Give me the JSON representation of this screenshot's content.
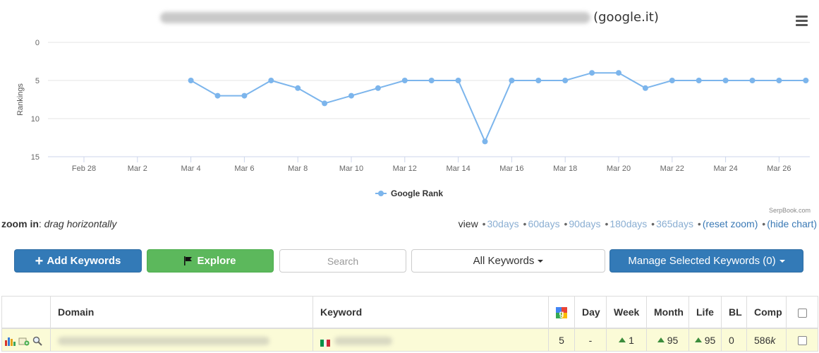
{
  "chart": {
    "title_suffix": "(google.it)",
    "credit": "SerpBook.com"
  },
  "chart_data": {
    "type": "line",
    "title": "(google.it)",
    "ylabel": "Rankings",
    "ylim": [
      0,
      15
    ],
    "y_inverted": true,
    "y_ticks": [
      "0",
      "5",
      "10",
      "15"
    ],
    "x_tick_labels": [
      "Feb 28",
      "Mar 2",
      "Mar 4",
      "Mar 6",
      "Mar 8",
      "Mar 10",
      "Mar 12",
      "Mar 14",
      "Mar 16",
      "Mar 18",
      "Mar 20",
      "Mar 22",
      "Mar 24",
      "Mar 26"
    ],
    "legend_position": "bottom-center",
    "series": [
      {
        "name": "Google Rank",
        "color": "#7cb5ec",
        "x": [
          "Mar 4",
          "Mar 5",
          "Mar 6",
          "Mar 7",
          "Mar 8",
          "Mar 9",
          "Mar 10",
          "Mar 11",
          "Mar 12",
          "Mar 13",
          "Mar 14",
          "Mar 15",
          "Mar 16",
          "Mar 17",
          "Mar 18",
          "Mar 19",
          "Mar 20",
          "Mar 21",
          "Mar 22",
          "Mar 23",
          "Mar 24",
          "Mar 25",
          "Mar 26",
          "Mar 27"
        ],
        "values": [
          5,
          7,
          7,
          5,
          6,
          8,
          7,
          6,
          5,
          5,
          5,
          13,
          5,
          5,
          5,
          4,
          4,
          6,
          5,
          5,
          5,
          5,
          5,
          5
        ]
      }
    ]
  },
  "zoom": {
    "label": "zoom in",
    "sep": ":",
    "hint": "drag horizontally",
    "view_label": "view",
    "options": [
      "30days",
      "60days",
      "90days",
      "180days",
      "365days"
    ],
    "reset": "(reset zoom)",
    "hide": "(hide chart)"
  },
  "toolbar": {
    "add_label": "Add Keywords",
    "explore_label": "Explore",
    "search_placeholder": "Search",
    "filter_label": "All Keywords",
    "manage_label": "Manage Selected Keywords (0)"
  },
  "table": {
    "headers": {
      "domain": "Domain",
      "keyword": "Keyword",
      "day": "Day",
      "week": "Week",
      "month": "Month",
      "life": "Life",
      "bl": "BL",
      "comp": "Comp"
    },
    "rows": [
      {
        "rank": "5",
        "day": "-",
        "week": "1",
        "month": "95",
        "life": "95",
        "bl": "0",
        "comp": "586",
        "comp_unit": "k"
      }
    ]
  },
  "colors": {
    "series": "#7cb5ec",
    "primary": "#337ab7",
    "success": "#5cb85c",
    "row_highlight": "#fbfbd7"
  }
}
